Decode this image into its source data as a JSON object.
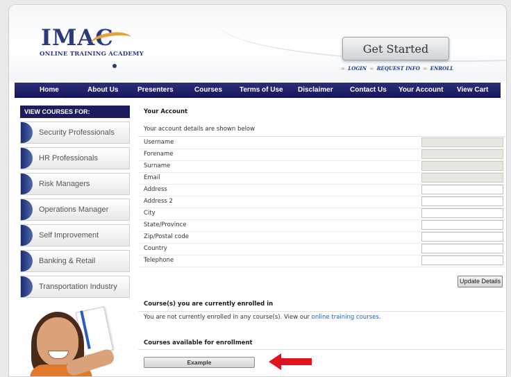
{
  "header": {
    "logo_text": "IMAC",
    "logo_subtitle": "ONLINE TRAINING ACADEMY",
    "get_started": "Get Started",
    "quick_links": [
      "LOGIN",
      "REQUEST INFO",
      "ENROLL"
    ],
    "quick_sep": "=",
    "accent_color": "#e8a13a",
    "brand_color": "#2b3a78"
  },
  "nav": {
    "items": [
      "Home",
      "About Us",
      "Presenters",
      "Courses",
      "Terms of Use",
      "Disclaimer",
      "Contact Us",
      "Your Account",
      "View Cart"
    ],
    "bg_color": "#1d1d5e"
  },
  "sidebar": {
    "heading": "VIEW COURSES FOR:",
    "items": [
      "Security Professionals",
      "HR Professionals",
      "Risk Managers",
      "Operations Manager",
      "Self Improvement",
      "Banking & Retail",
      "Transportation Industry"
    ]
  },
  "account": {
    "title": "Your Account",
    "intro": "Your account details are shown below",
    "fields": [
      {
        "label": "Username",
        "value": "",
        "readonly": true
      },
      {
        "label": "Forename",
        "value": "",
        "readonly": true
      },
      {
        "label": "Surname",
        "value": "",
        "readonly": true
      },
      {
        "label": "Email",
        "value": "",
        "readonly": true
      },
      {
        "label": "Address",
        "value": "",
        "readonly": false
      },
      {
        "label": "Address 2",
        "value": "",
        "readonly": false
      },
      {
        "label": "City",
        "value": "",
        "readonly": false
      },
      {
        "label": "State/Province",
        "value": "",
        "readonly": false
      },
      {
        "label": "Zip/Postal code",
        "value": "",
        "readonly": false
      },
      {
        "label": "Country",
        "value": "",
        "readonly": false
      },
      {
        "label": "Telephone",
        "value": "",
        "readonly": false
      }
    ],
    "update_button": "Update Details"
  },
  "enrolled": {
    "title": "Course(s) you are currently enrolled in",
    "text_before": "You are not currently enrolled in any course(s). View our ",
    "link": "online training courses",
    "text_after": "."
  },
  "available": {
    "title": "Courses available for enrollment",
    "course_button": "Example",
    "arrow_color": "#e0141e"
  }
}
